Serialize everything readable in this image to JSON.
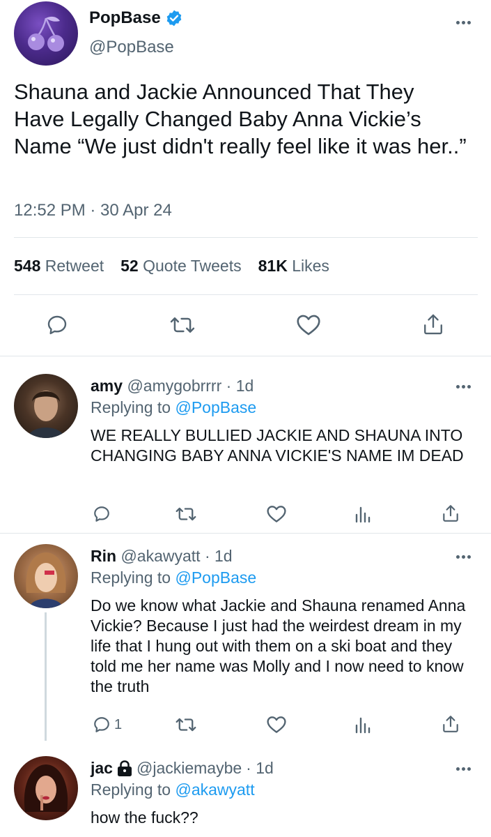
{
  "main_tweet": {
    "name": "PopBase",
    "handle": "@PopBase",
    "text": "Shauna and Jackie Announced That They Have Legally Changed Baby Anna Vickie’s Name “We just didn't really feel like it was her..”",
    "timestamp": "12:52 PM · 30 Apr 24",
    "stats": {
      "retweets_count": "548",
      "retweets_label": "Retweet",
      "quotes_count": "52",
      "quotes_label": "Quote Tweets",
      "likes_count": "81K",
      "likes_label": "Likes"
    }
  },
  "replies": [
    {
      "name": "amy",
      "handle": "@amygobrrrr",
      "age": "· 1d",
      "replying_label": "Replying to",
      "replying_to": "@PopBase",
      "text": "WE REALLY BULLIED JACKIE AND SHAUNA INTO CHANGING BABY ANNA VICKIE'S NAME IM DEAD",
      "reply_count": ""
    },
    {
      "name": "Rin",
      "handle": "@akawyatt",
      "age": "· 1d",
      "replying_label": "Replying to",
      "replying_to": "@PopBase",
      "text": "Do we know what Jackie and Shauna renamed Anna Vickie? Because I just had the weirdest dream in my life that I hung out with them on a ski boat and they told me her name was Molly and I now need to know the truth",
      "reply_count": "1"
    },
    {
      "name": "jac",
      "handle": "@jackiemaybe",
      "age": "· 1d",
      "replying_label": "Replying to",
      "replying_to": "@akawyatt",
      "text": "how the fuck??",
      "reply_count": ""
    }
  ],
  "colors": {
    "accent": "#1d9bf0",
    "secondary_text": "#536471",
    "primary_text": "#0f1419",
    "divider": "#e1e6ea"
  },
  "icons": [
    "cherry-logo-icon",
    "verified-badge-icon",
    "more-icon",
    "reply-icon",
    "retweet-icon",
    "like-icon",
    "share-icon",
    "analytics-icon",
    "lock-icon"
  ]
}
